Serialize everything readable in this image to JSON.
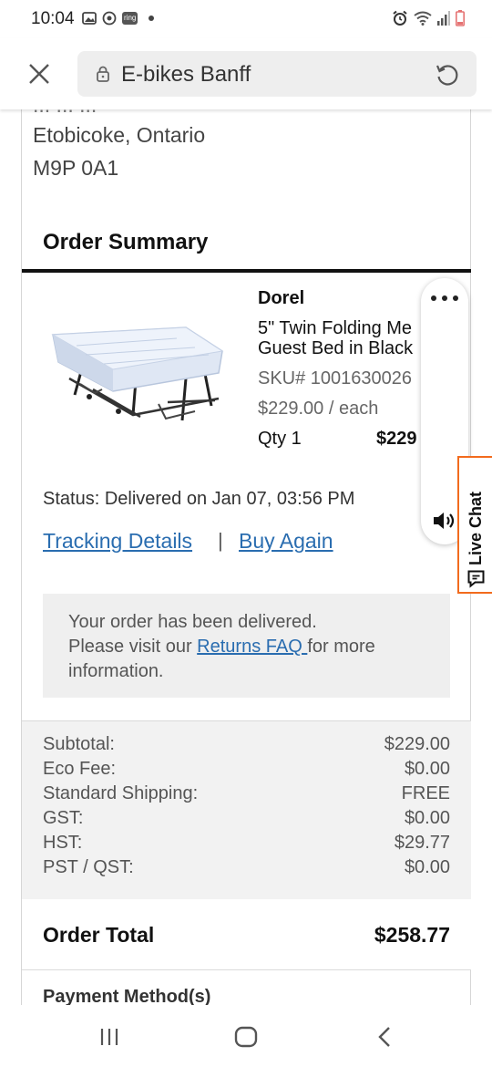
{
  "status_bar": {
    "time": "10:04",
    "ring_badge": "ring",
    "icons_left": [
      "image-icon",
      "circle-icon",
      "ring-icon",
      "dot-icon"
    ],
    "icons_right": [
      "alarm-icon",
      "wifi-icon",
      "signal-icon",
      "battery-icon"
    ]
  },
  "browser": {
    "url_text": "E-bikes Banff",
    "icons": [
      "close-icon",
      "lock-icon",
      "reload-icon"
    ]
  },
  "address": {
    "partial_line": "... ... ...",
    "city_line": "Etobicoke, Ontario",
    "postal_line": "M9P 0A1"
  },
  "order_summary": {
    "title": "Order Summary",
    "product": {
      "brand": "Dorel",
      "name_line1": "5\" Twin Folding Me",
      "name_line2": "Guest Bed in Black",
      "sku": "SKU# 1001630026",
      "price_each": "$229.00 / each",
      "qty": "Qty 1",
      "line_total": "$229"
    },
    "status": "Status: Delivered on Jan 07, 03:56 PM",
    "tracking_link": "Tracking Details",
    "separator": "|",
    "buy_again_link": "Buy Again",
    "notice": {
      "line1": "Your order has been delivered.",
      "line2_prefix": "Please visit our ",
      "returns_link": "Returns FAQ ",
      "line2_suffix": "for more",
      "line3": "information."
    }
  },
  "totals": {
    "rows": [
      {
        "label": "Subtotal:",
        "value": "$229.00"
      },
      {
        "label": "Eco Fee:",
        "value": "$0.00"
      },
      {
        "label": "Standard Shipping:",
        "value": "FREE"
      },
      {
        "label": "GST:",
        "value": "$0.00"
      },
      {
        "label": "HST:",
        "value": "$29.77"
      },
      {
        "label": "PST / QST:",
        "value": "$0.00"
      }
    ],
    "order_total_label": "Order Total",
    "order_total_value": "$258.77"
  },
  "payment": {
    "title": "Payment Method(s)"
  },
  "live_chat": {
    "label": "Live Chat",
    "accent_color": "#f26b1d"
  },
  "colors": {
    "link": "#2a6db0",
    "notice_bg": "#efefef",
    "totals_bg": "#f2f2f2"
  },
  "nav_bar": {
    "buttons": [
      "recent-apps-icon",
      "home-icon",
      "back-icon"
    ]
  }
}
